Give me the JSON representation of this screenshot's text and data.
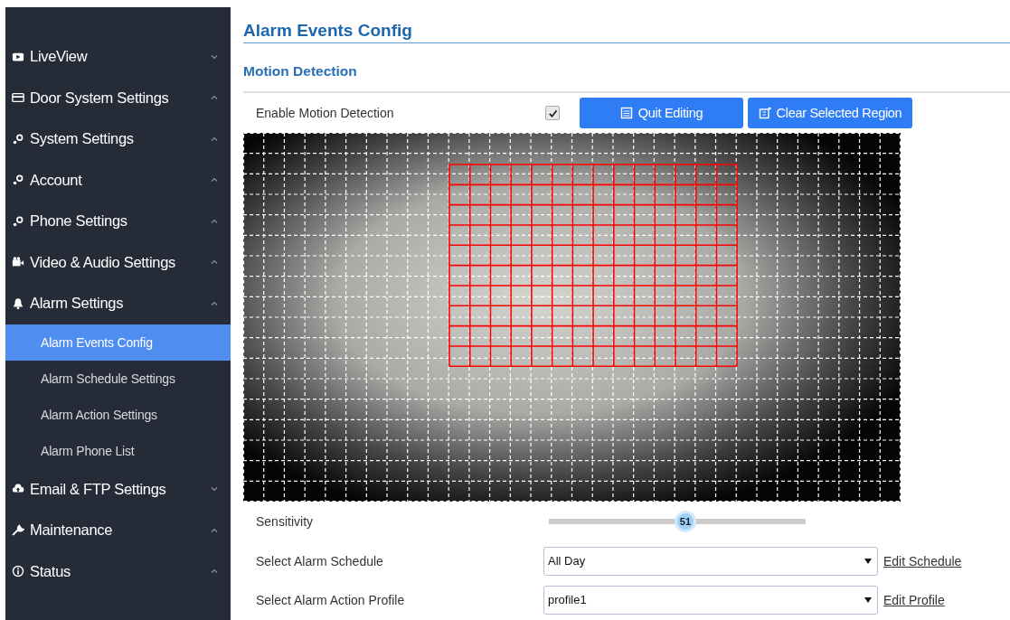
{
  "sidebar": {
    "items": [
      {
        "label": "LiveView"
      },
      {
        "label": "Door System Settings"
      },
      {
        "label": "System Settings"
      },
      {
        "label": "Account"
      },
      {
        "label": "Phone Settings"
      },
      {
        "label": "Video & Audio Settings"
      },
      {
        "label": "Alarm Settings",
        "children": [
          {
            "label": "Alarm Events Config",
            "selected": true
          },
          {
            "label": "Alarm Schedule Settings",
            "selected": false
          },
          {
            "label": "Alarm Action Settings",
            "selected": false
          },
          {
            "label": "Alarm Phone List",
            "selected": false
          }
        ]
      },
      {
        "label": "Email & FTP Settings"
      },
      {
        "label": "Maintenance"
      },
      {
        "label": "Status"
      }
    ]
  },
  "page_title": "Alarm Events Config",
  "section_title": "Motion Detection",
  "enable": {
    "label": "Enable Motion Detection",
    "checked": true
  },
  "buttons": [
    {
      "label": "Quit Editing"
    },
    {
      "label": "Clear Selected Region"
    }
  ],
  "sensitivity": {
    "label": "Sensitivity",
    "level": 0.51,
    "reading": "51"
  },
  "selects": [
    {
      "label": "Select Alarm Schedule",
      "value": "All Day",
      "link": "Edit Schedule"
    },
    {
      "label": "Select Alarm Action Profile",
      "value": "profile1",
      "link": "Edit Profile"
    }
  ]
}
